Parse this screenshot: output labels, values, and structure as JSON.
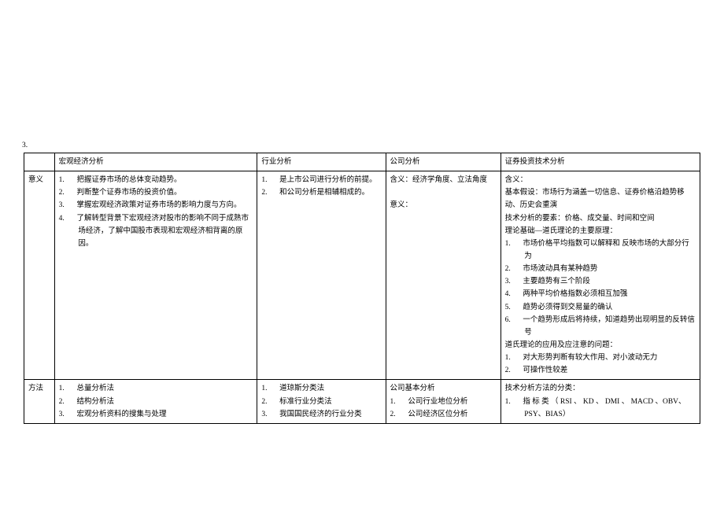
{
  "page_number_label": "3.",
  "headers": {
    "row_label_col": "",
    "macro": "宏观经济分析",
    "industry": "行业分析",
    "company": "公司分析",
    "technical": "证券投资技术分析"
  },
  "row_labels": {
    "meaning": "意义",
    "method": "方法"
  },
  "meaning": {
    "macro": [
      "把握证券市场的总体变动趋势。",
      "判断整个证券市场的投资价值。",
      "掌握宏观经济政策对证券市场的影响力度与方向。",
      "了解转型背景下宏观经济对股市的影响不同于成熟市场经济，了解中国股市表现和宏观经济相背离的原因。"
    ],
    "industry": [
      "是上市公司进行分析的前提。",
      "和公司分析是相辅相成的。"
    ],
    "company": {
      "line1": "含义：经济学角度、立法角度",
      "line2": "意义："
    },
    "technical": {
      "def_label": "含义：",
      "assumption_label": "基本假设：市场行为涵盖一切信息、证券价格沿趋势移动、历史会重演",
      "elements_label": "技术分析的要素：价格、成交量、时间和空间",
      "theory_basis_label": "理论基础—道氏理论的主要原理：",
      "theory_points": [
        "市场价格平均指数可以解释和 反映市场的大部分行为",
        "市场波动具有某种趋势",
        "主要趋势有三个阶段",
        "两种平均价格指数必须相互加强",
        "趋势必须得到交易量的确认",
        "一个趋势形成后将持续，知道趋势出现明显的反转信号"
      ],
      "dow_issues_label": "道氏理论的应用及应注意的问题：",
      "dow_issues": [
        "对大形势判断有较大作用、对小波动无力",
        "可操作性较差"
      ]
    }
  },
  "method": {
    "macro": [
      "总量分析法",
      "结构分析法",
      "宏观分析资料的搜集与处理"
    ],
    "industry": [
      "道琼斯分类法",
      "标准行业分类法",
      "我国国民经济的行业分类"
    ],
    "company": {
      "header": "公司基本分析",
      "items": [
        "公司行业地位分析",
        "公司经济区位分析"
      ]
    },
    "technical": {
      "header": "技术分析方法的分类：",
      "items": [
        "指 标 类 （ RSI 、 KD 、 DMI 、 MACD 、OBV、PSY、BIAS）"
      ]
    }
  }
}
